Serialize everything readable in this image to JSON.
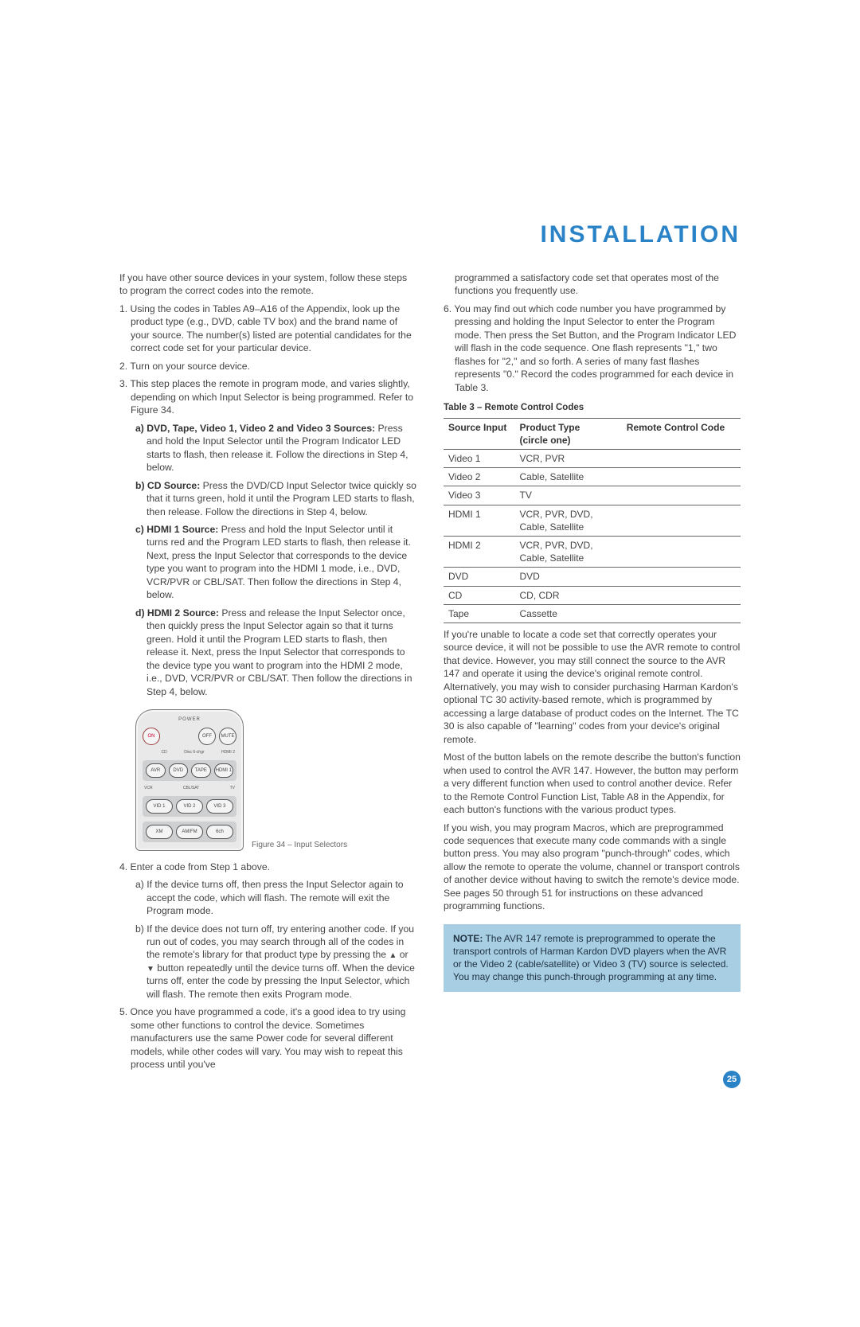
{
  "page_title": "INSTALLATION",
  "page_number": "25",
  "figure": {
    "power_label": "POWER",
    "buttons_top": {
      "on": "ON",
      "off": "OFF",
      "mute": "MUTE"
    },
    "tiny": {
      "cd": "CD",
      "disc": "Disc 6-chgr",
      "hdmi2": "HDMI 2"
    },
    "row1": [
      "AVR",
      "DVD",
      "TAPE",
      "HDMI 1"
    ],
    "tiny2": {
      "vcr": "VCR",
      "cbl": "CBL/SAT",
      "tv": "TV"
    },
    "row2": [
      "VID 1",
      "VID 2",
      "VID 3"
    ],
    "row3": [
      "XM",
      "AM/FM",
      "6ch"
    ],
    "caption": "Figure 34 – Input Selectors"
  },
  "left": {
    "intro": "If you have other source devices in your system, follow these steps to program the correct codes into the remote.",
    "s1": "1. Using the codes in Tables A9–A16 of the Appendix, look up the product type (e.g., DVD, cable TV box) and the brand name of your source. The number(s) listed are potential candidates for the correct code set for your particular device.",
    "s2": "2. Turn on your source device.",
    "s3": "3. This step places the remote in program mode, and varies slightly, depending on which Input Selector is being programmed. Refer to Figure 34.",
    "s3a_label": "a) DVD, Tape, Video 1, Video 2 and Video 3 Sources:",
    "s3a": " Press and hold the Input Selector until the Program Indicator LED starts to flash, then release it. Follow the directions in Step 4, below.",
    "s3b_label": "b) CD Source:",
    "s3b": " Press the DVD/CD Input Selector twice quickly so that it turns green, hold it until the Program LED starts to flash, then release. Follow the directions in Step 4, below.",
    "s3c_label": "c) HDMI 1 Source:",
    "s3c": " Press and hold the Input Selector until it turns red and the Program LED starts to flash, then release it. Next, press the Input Selector that corresponds to the device type you want to program into the HDMI 1 mode, i.e., DVD, VCR/PVR or CBL/SAT. Then follow the directions in Step 4, below.",
    "s3d_label": "d) HDMI 2 Source:",
    "s3d": " Press and release the Input Selector once, then quickly press the Input Selector again so that it turns green. Hold it until the Program LED starts to flash, then release it. Next, press the Input Selector that corresponds to the device type you want to program into the HDMI 2 mode, i.e., DVD, VCR/PVR or CBL/SAT. Then follow the directions in Step 4, below.",
    "s4": "4. Enter a code from Step 1 above.",
    "s4a": "a) If the device turns off, then press the Input Selector again to accept the code, which will flash. The remote will exit the Program mode.",
    "s4b_pre": "b) If the device does not turn off, try entering another code. If you run out of codes, you may search through all of the codes in the remote's library for that product type by pressing the ",
    "s4b_post": " button repeatedly until the device turns off. When the device turns off, enter the code by pressing the Input Selector, which will flash. The remote then exits Program mode.",
    "s5": "5. Once you have programmed a code, it's a good idea to try using some other functions to control the device. Sometimes manufacturers use the same Power code for several different models, while other codes will vary. You may wish to repeat this process until you've"
  },
  "right": {
    "cont": "programmed a satisfactory code set that operates most of the functions you frequently use.",
    "s6": "6. You may find out which code number you have programmed by pressing and holding the Input Selector to enter the Program mode. Then press the Set Button, and the Program Indicator LED will flash in the code sequence. One flash represents \"1,\" two flashes for \"2,\" and so forth. A series of many fast flashes represents \"0.\" Record the codes programmed for each device in Table 3.",
    "table_title": "Table 3 – Remote Control Codes",
    "th1": "Source Input",
    "th2a": "Product Type",
    "th2b": "(circle one)",
    "th3": "Remote Control Code",
    "rows": [
      {
        "src": "Video 1",
        "pt": "VCR, PVR"
      },
      {
        "src": "Video 2",
        "pt": "Cable, Satellite"
      },
      {
        "src": "Video 3",
        "pt": "TV"
      },
      {
        "src": "HDMI 1",
        "pt": "VCR, PVR, DVD, Cable, Satellite"
      },
      {
        "src": "HDMI 2",
        "pt": "VCR, PVR, DVD, Cable, Satellite"
      },
      {
        "src": "DVD",
        "pt": "DVD"
      },
      {
        "src": "CD",
        "pt": "CD, CDR"
      },
      {
        "src": "Tape",
        "pt": "Cassette"
      }
    ],
    "p1": "If you're unable to locate a code set that correctly operates your source device, it will not be possible to use the AVR remote to control that device. However, you may still connect the source to the AVR 147 and operate it using the device's original remote control. Alternatively, you may wish to consider purchasing Harman Kardon's optional TC 30 activity-based remote, which is programmed by accessing a large database of product codes on the Internet. The TC 30 is also capable of \"learning\" codes from your device's original remote.",
    "p2": "Most of the button labels on the remote describe the button's function when used to control the AVR 147. However, the button may perform a very different function when used to control another device. Refer to the Remote Control Function List, Table A8 in the Appendix, for each button's functions with the various product types.",
    "p3": "If you wish, you may program Macros, which are preprogrammed code sequences that execute many code commands with a single button press. You may also program \"punch-through\" codes, which allow the remote to operate the volume, channel or transport controls of another device without having to switch the remote's device mode. See pages 50 through 51 for instructions on these advanced programming functions.",
    "note_label": "NOTE:",
    "note": " The AVR 147 remote is preprogrammed to operate the transport controls of Harman Kardon DVD players when the AVR or the Video 2 (cable/satellite) or Video 3 (TV) source is selected. You may change this punch-through programming at any time."
  }
}
